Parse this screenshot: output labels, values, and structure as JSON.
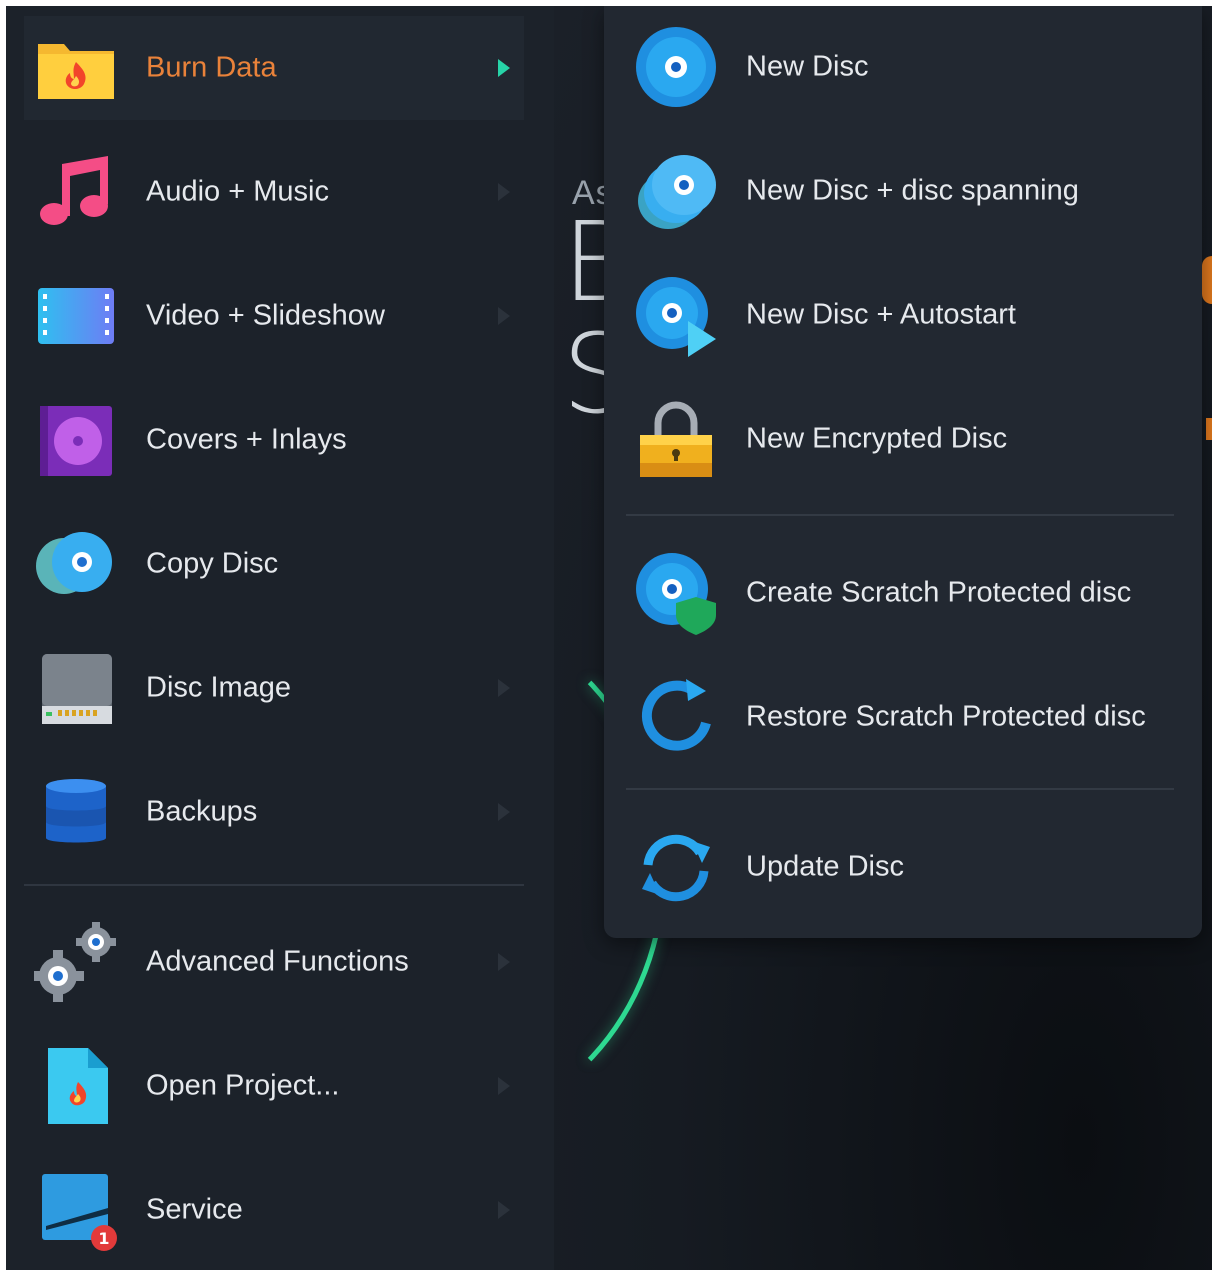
{
  "background": {
    "title_small": "As",
    "title_big_1": "B",
    "title_big_2": "S"
  },
  "left_menu": {
    "items": [
      {
        "label": "Burn Data",
        "icon": "folder-fire-icon",
        "active": true
      },
      {
        "label": "Audio + Music",
        "icon": "music-note-icon"
      },
      {
        "label": "Video + Slideshow",
        "icon": "film-strip-icon"
      },
      {
        "label": "Covers + Inlays",
        "icon": "cover-disc-icon"
      },
      {
        "label": "Copy Disc",
        "icon": "copy-disc-icon"
      },
      {
        "label": "Disc Image",
        "icon": "disc-image-drive-icon"
      },
      {
        "label": "Backups",
        "icon": "database-icon"
      },
      {
        "label": "Advanced Functions",
        "icon": "gears-icon"
      },
      {
        "label": "Open Project...",
        "icon": "project-file-icon"
      },
      {
        "label": "Service",
        "icon": "service-icon",
        "badge": "1"
      }
    ]
  },
  "submenu": {
    "items": [
      {
        "label": "New Disc",
        "icon": "disc-icon"
      },
      {
        "label": "New Disc + disc spanning",
        "icon": "disc-spanning-icon"
      },
      {
        "label": "New Disc + Autostart",
        "icon": "disc-autostart-icon"
      },
      {
        "label": "New Encrypted Disc",
        "icon": "padlock-icon"
      },
      {
        "label": "Create Scratch Protected disc",
        "icon": "disc-shield-icon"
      },
      {
        "label": "Restore Scratch Protected disc",
        "icon": "restore-arrow-icon"
      },
      {
        "label": "Update Disc",
        "icon": "sync-arrows-icon"
      }
    ]
  },
  "colors": {
    "accent_orange": "#e9823a",
    "accent_teal": "#27d4a8",
    "ring_green": "#2ed991",
    "disc_blue": "#1f8fe0"
  }
}
